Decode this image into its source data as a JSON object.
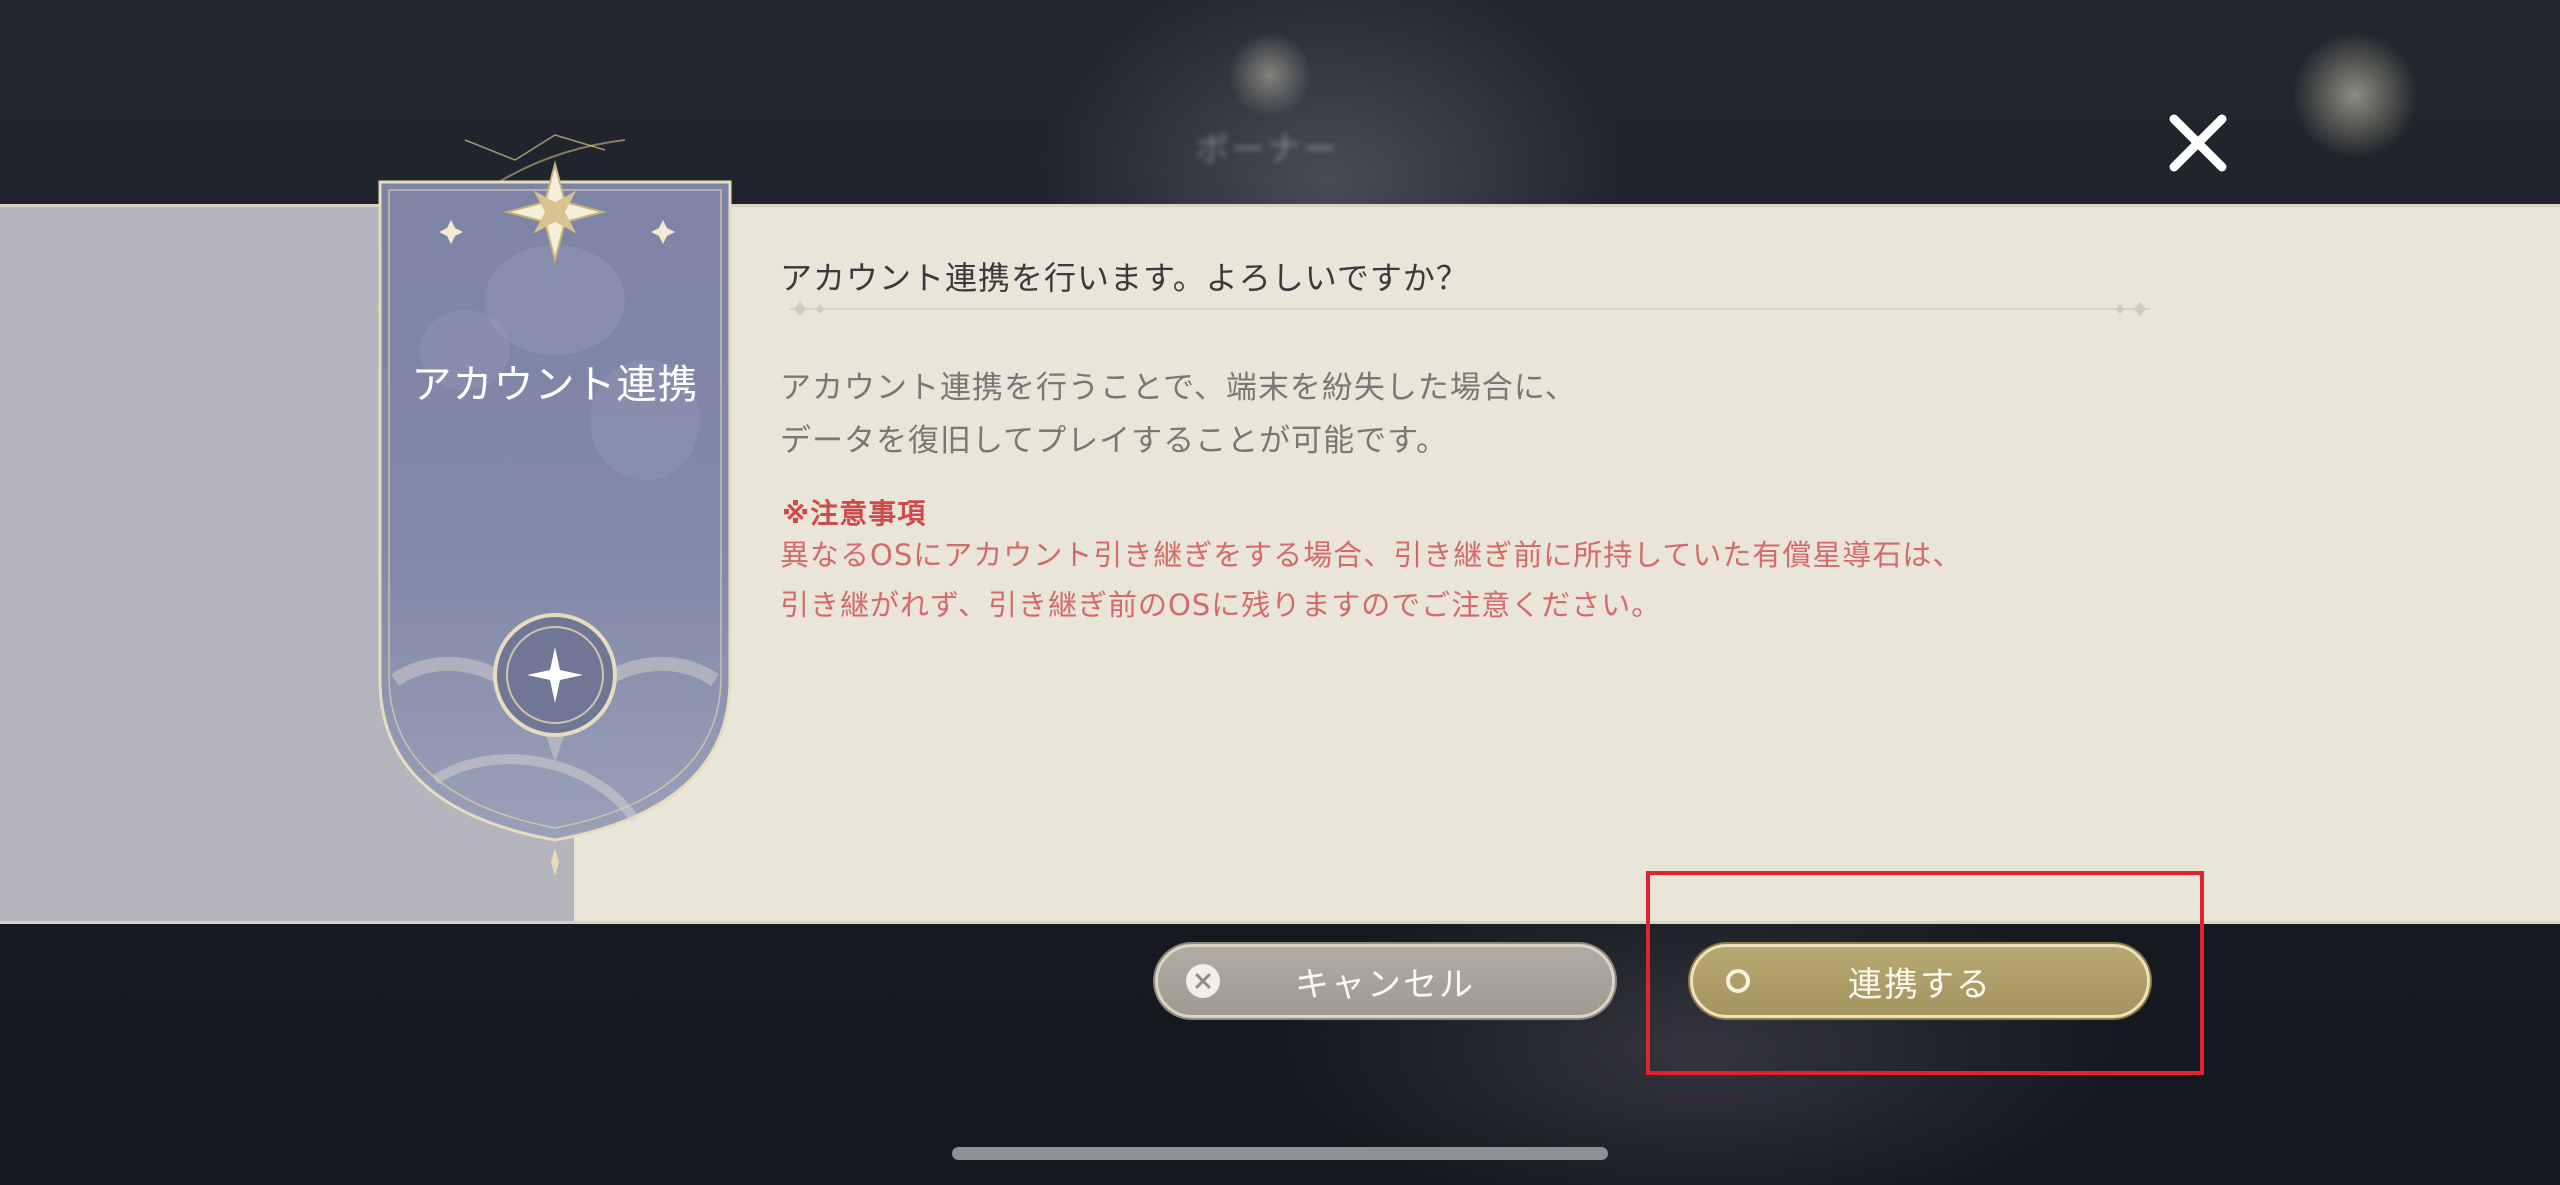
{
  "background": {
    "title_blurred": "ボーナー"
  },
  "close_button": {
    "icon": "close-icon"
  },
  "banner": {
    "label": "アカウント連携",
    "top_icon": "star-emblem-icon",
    "bottom_icon": "moon-star-emblem-icon"
  },
  "dialog": {
    "heading": "アカウント連携を行います。よろしいですか？",
    "body_lines": [
      "アカウント連携を行うことで、端末を紛失した場合に、",
      "データを復旧してプレイすることが可能です。"
    ],
    "notice_title": "※注意事項",
    "notice_lines": [
      "異なるOSにアカウント引き継ぎをする場合、引き継ぎ前に所持していた有償星導石は、",
      "引き継がれず、引き継ぎ前のOSに残りますのでご注意ください。"
    ]
  },
  "buttons": {
    "cancel": {
      "label": "キャンセル",
      "icon": "x-circle-icon"
    },
    "confirm": {
      "label": "連携する",
      "icon": "o-circle-icon"
    }
  },
  "colors": {
    "panel": "#e9e5d8",
    "banner": "#7a82a3",
    "notice": "#d46a6a",
    "confirm_button": "#ad9d66",
    "cancel_button": "#a8a39b",
    "highlight": "#e0232e"
  }
}
